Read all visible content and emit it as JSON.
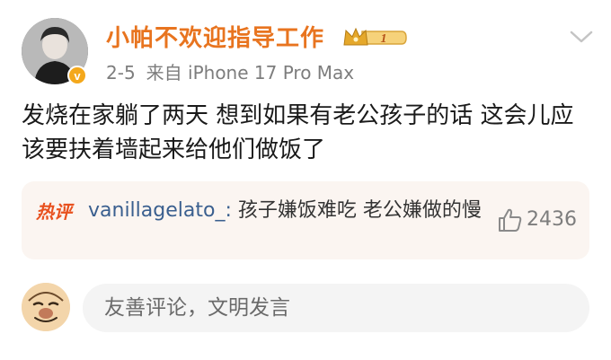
{
  "post": {
    "username": "小帕不欢迎指导工作",
    "level": "1",
    "date": "2-5",
    "source": "来自 iPhone 17 Pro Max",
    "text": "发烧在家躺了两天 想到如果有老公孩子的话 这会儿应该要扶着墙起来给他们做饭了"
  },
  "hot_comment": {
    "tag": "热评",
    "user": "vanillagelato_",
    "separator": ":",
    "text": " 孩子嫌饭难吃 老公嫌做的慢",
    "likes": "2436"
  },
  "comment_input": {
    "placeholder": "友善评论，文明发言"
  },
  "colors": {
    "username": "#e8741f",
    "hot_tag": "#e8511f",
    "hot_bg": "#fbf5f1",
    "input_bg": "#f4f4f4"
  },
  "icons": [
    "avatar",
    "verified-badge-icon",
    "crown-level-icon",
    "chevron-down-icon",
    "thumbs-up-icon"
  ]
}
